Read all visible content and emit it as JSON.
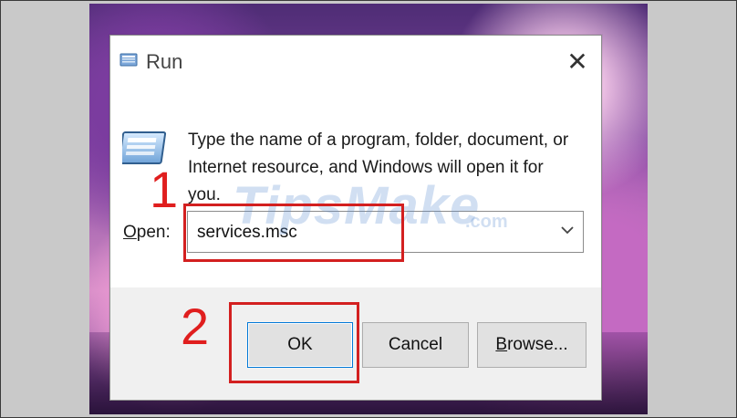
{
  "window": {
    "title": "Run",
    "close_glyph": "✕"
  },
  "description": "Type the name of a program, folder, document, or Internet resource, and Windows will open it for you.",
  "open_field": {
    "label_accel": "O",
    "label_rest": "pen:",
    "value": "services.msc"
  },
  "buttons": {
    "ok": "OK",
    "cancel": "Cancel",
    "browse_accel": "B",
    "browse_rest": "rowse..."
  },
  "annotations": {
    "step1": "1",
    "step2": "2",
    "highlight_color": "#d32020"
  },
  "watermark": {
    "main": "TipsMake",
    "sub": ".com"
  },
  "icons": {
    "title": "run-app-icon",
    "main": "run-app-icon",
    "dropdown": "chevron-down-icon",
    "close": "close-icon"
  }
}
